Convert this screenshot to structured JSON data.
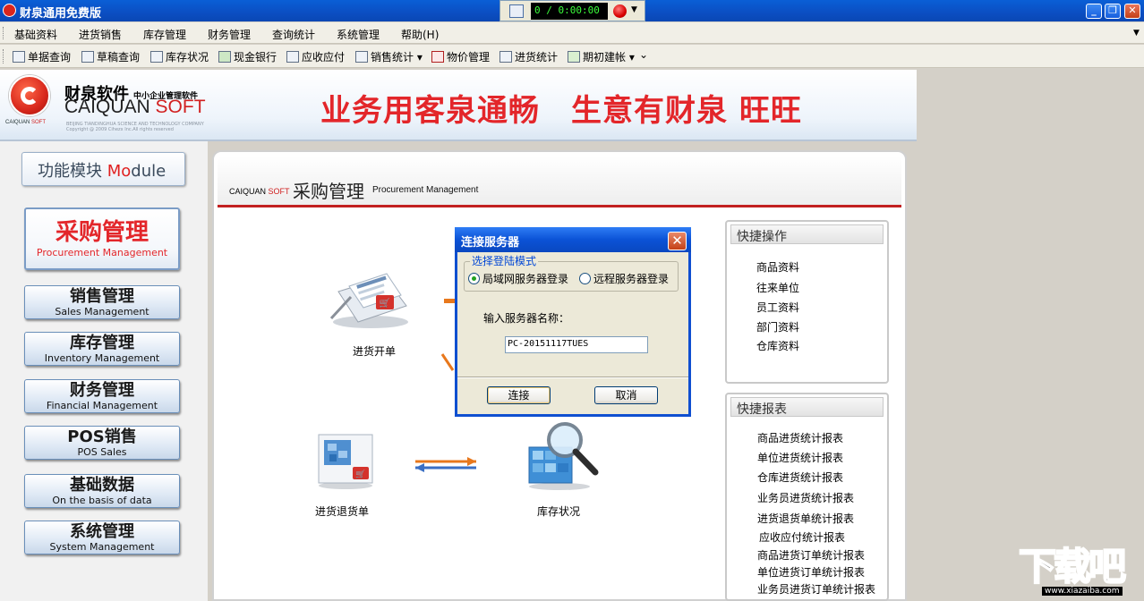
{
  "window": {
    "title": "财泉通用免费版"
  },
  "recorder": {
    "timer": "0 / 0:00:00"
  },
  "menu": [
    "基础资料",
    "进货销售",
    "库存管理",
    "财务管理",
    "查询统计",
    "系统管理",
    "帮助(H)"
  ],
  "toolbar": [
    "单据查询",
    "草稿查询",
    "库存状况",
    "现金银行",
    "应收应付",
    "销售统计",
    "物价管理",
    "进货统计",
    "期初建帐"
  ],
  "banner": {
    "brand_cn": "财泉软件",
    "brand_cn_small": "中小企业管理软件",
    "brand_en_1": "CAIQUAN",
    "brand_en_2": "SOFT",
    "logo_text_1": "CAIQUAN",
    "logo_text_2": "SOFT",
    "fine_print_1": "BEIJING TIANDINGHUA SCIENCE AND TECHNOLOGY COMPANY",
    "fine_print_2": "Copyright @ 2009 Cihezx Inc.All rights reserved",
    "slogan": "业务用客泉通畅　生意有财泉 旺旺"
  },
  "modules": {
    "header_cn": "功能模块",
    "header_en_1": "Mo",
    "header_en_2": "dule",
    "items": [
      {
        "cn": "采购管理",
        "en": "Procurement Management"
      },
      {
        "cn": "销售管理",
        "en": "Sales Management"
      },
      {
        "cn": "库存管理",
        "en": "Inventory Management"
      },
      {
        "cn": "财务管理",
        "en": "Financial Management"
      },
      {
        "cn": "POS销售",
        "en": "POS Sales"
      },
      {
        "cn": "基础数据",
        "en": "On the basis of data"
      },
      {
        "cn": "系统管理",
        "en": "System Management"
      }
    ]
  },
  "content": {
    "brand_1": "CAIQUAN",
    "brand_2": "SOFT",
    "title": "采购管理",
    "title_en": "Procurement Management",
    "flow": {
      "purchase": "进货开单",
      "return": "进货退货单",
      "stock": "库存状况"
    }
  },
  "quick_ops": {
    "title": "快捷操作",
    "items": [
      "商品资料",
      "往来单位",
      "员工资料",
      "部门资料",
      "仓库资料"
    ]
  },
  "quick_reports": {
    "title": "快捷报表",
    "items": [
      "商品进货统计报表",
      "单位进货统计报表",
      "仓库进货统计报表",
      "业务员进货统计报表",
      "进货退货单统计报表",
      "应收应付统计报表",
      "商品进货订单统计报表",
      "单位进货订单统计报表",
      "业务员进货订单统计报表"
    ]
  },
  "dialog": {
    "title": "连接服务器",
    "group_label": "选择登陆模式",
    "radio_lan": "局域网服务器登录",
    "radio_remote": "远程服务器登录",
    "server_label": "输入服务器名称：",
    "server_value": "PC-20151117TUES",
    "connect": "连接",
    "cancel": "取消"
  },
  "watermark": {
    "text": "下载吧",
    "url": "www.xiazaiba.com"
  }
}
